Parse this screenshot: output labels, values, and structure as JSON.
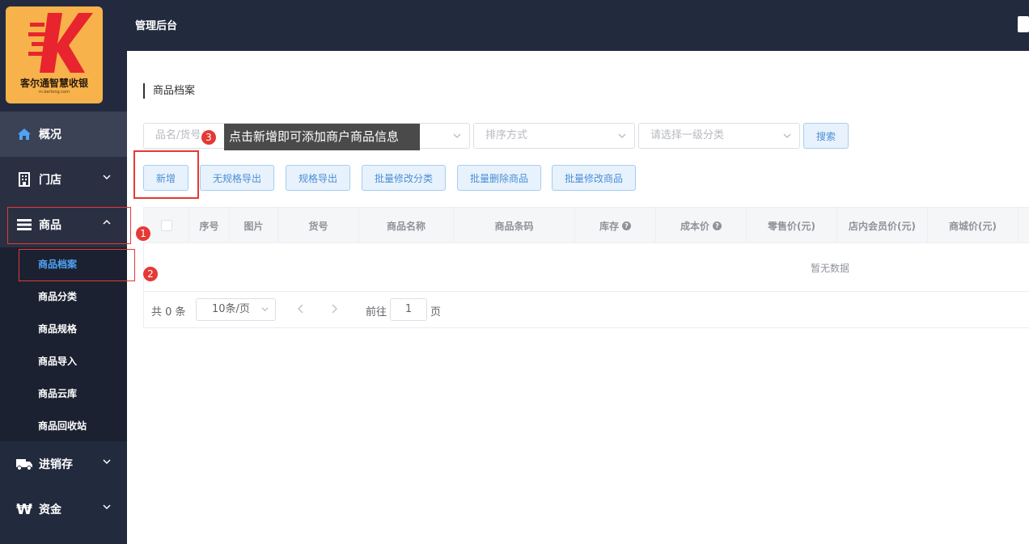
{
  "sidebar": {
    "logo_text": "客尔通智慧收银",
    "logo_sub": "m.kertong.com",
    "nav": {
      "overview": "概况",
      "store": "门店",
      "goods": "商品",
      "inventory": "进销存",
      "funds": "资金"
    },
    "submenu": [
      "商品档案",
      "商品分类",
      "商品规格",
      "商品导入",
      "商品云库",
      "商品回收站"
    ]
  },
  "header": {
    "title": "管理后台"
  },
  "breadcrumb": "商品档案",
  "filters": {
    "search_placeholder": "品名/货号/条",
    "sort_placeholder": "排序方式",
    "category_placeholder": "请选择一级分类",
    "search_button": "搜索"
  },
  "toolbar": {
    "add": "新增",
    "export_no_spec": "无规格导出",
    "export_spec": "规格导出",
    "batch_category": "批量修改分类",
    "batch_delete": "批量删除商品",
    "batch_modify": "批量修改商品"
  },
  "tooltip": "点击新增即可添加商户商品信息",
  "badges": [
    "1",
    "2",
    "3"
  ],
  "table": {
    "columns": [
      "序号",
      "图片",
      "货号",
      "商品名称",
      "商品条码",
      "库存",
      "成本价",
      "零售价(元)",
      "店内会员价(元)",
      "商城价(元)"
    ],
    "empty_text": "暂无数据"
  },
  "pagination": {
    "total": "共 0 条",
    "page_size": "10条/页",
    "goto_label": "前往",
    "page": "1",
    "page_suffix": "页"
  },
  "colors": {
    "sidebar": "#222a3d",
    "accent": "#4a8fd6",
    "highlight": "#e53935",
    "logo_bg": "#f7b24b"
  }
}
